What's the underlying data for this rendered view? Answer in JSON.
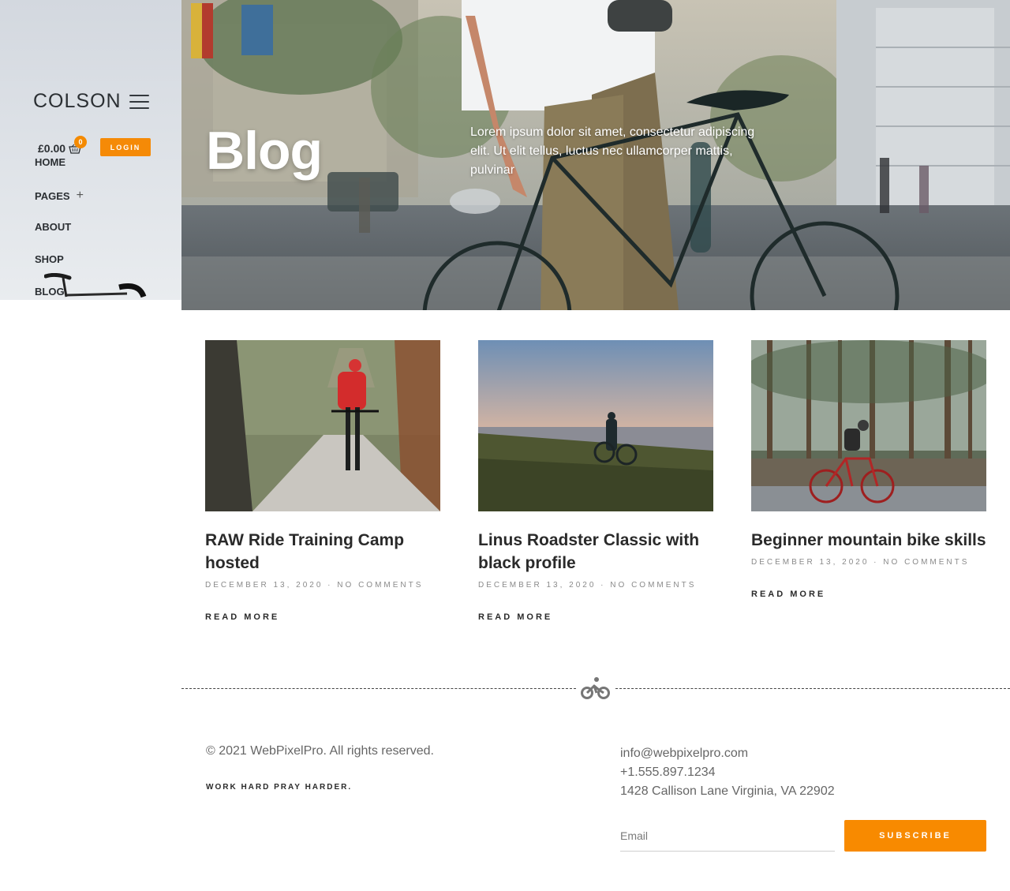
{
  "brand": {
    "name": "COLSON"
  },
  "cart": {
    "amount": "£0.00",
    "count": "0"
  },
  "login": {
    "label": "LOGIN"
  },
  "nav": {
    "items": [
      {
        "label": "HOME"
      },
      {
        "label": "PAGES",
        "expand": "+"
      },
      {
        "label": "ABOUT"
      },
      {
        "label": "SHOP"
      },
      {
        "label": "BLOG"
      }
    ]
  },
  "hero": {
    "title": "Blog",
    "text": "Lorem ipsum dolor sit amet, consectetur adipiscing elit. Ut elit tellus, luctus nec ullamcorper mattis, pulvinar"
  },
  "posts": [
    {
      "title": "RAW Ride Training Camp hosted",
      "date": "DECEMBER 13, 2020",
      "sep": "·",
      "comments": "NO COMMENTS",
      "read_more": "READ MORE"
    },
    {
      "title": "Linus Roadster Classic with black profile",
      "date": "DECEMBER 13, 2020",
      "sep": "·",
      "comments": "NO COMMENTS",
      "read_more": "READ MORE"
    },
    {
      "title": "Beginner mountain bike skills",
      "date": "DECEMBER 13, 2020",
      "sep": "·",
      "comments": "NO COMMENTS",
      "read_more": "READ MORE"
    }
  ],
  "footer": {
    "copyright": "© 2021 WebPixelPro. All rights reserved.",
    "tagline": "WORK HARD PRAY HARDER.",
    "email": "info@webpixelpro.com",
    "phone": "+1.555.897.1234",
    "address": "1428 Callison Lane Virginia, VA 22902",
    "email_placeholder": "Email",
    "subscribe_label": "SUBSCRIBE"
  },
  "colors": {
    "accent": "#f88a00",
    "text": "#2a2a2a",
    "muted": "#8a8a8a"
  },
  "icons": [
    "hamburger-icon",
    "basket-icon",
    "plus-icon",
    "bicycle-icon"
  ]
}
